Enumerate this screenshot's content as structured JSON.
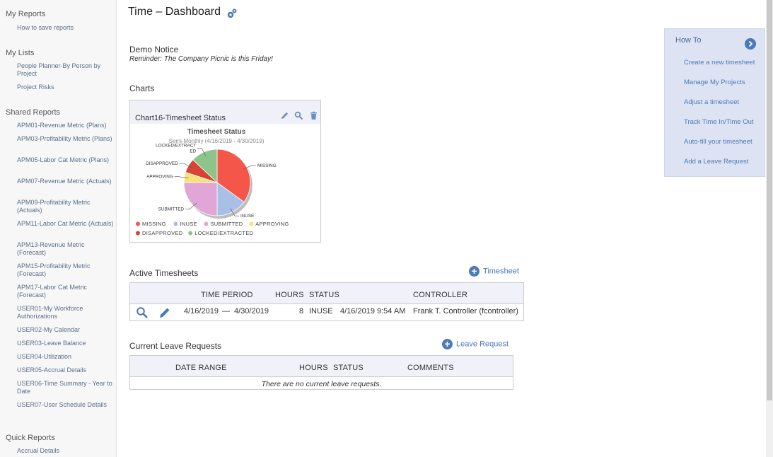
{
  "sidebar": {
    "my_reports": {
      "title": "My Reports",
      "items": [
        "How to save reports"
      ]
    },
    "my_lists": {
      "title": "My Lists",
      "items": [
        "People Planner-By Person by Project",
        "Project Risks"
      ]
    },
    "shared_reports": {
      "title": "Shared Reports",
      "items": [
        "APM01-Revenue Metric (Plans)",
        "APM03-Profitability Metric (Plans)",
        "APM05-Labor Cat Metric (Plans)",
        "APM07-Revenue Metric (Actuals)",
        "APM09-Profitability Metric (Actuals)",
        "APM11-Labor Cat Metric (Actuals)",
        "APM13-Revenue Metric (Forecast)",
        "APM15-Profitability Metric (Forecast)",
        "APM17-Labor Cat Metric (Forecast)",
        "USER01-My Workforce Authorizations",
        "USER02-My Calendar",
        "USER03-Leave Balance",
        "USER04-Utilization",
        "USER05-Accrual Details",
        "USER06-Time Summary - Year to Date",
        "USER07-User Schedule Details"
      ]
    },
    "quick_reports": {
      "title": "Quick Reports",
      "items": [
        "Accrual Details"
      ]
    }
  },
  "page": {
    "title": "Time – Dashboard"
  },
  "notice": {
    "heading": "Demo Notice",
    "text": "Reminder: The Company Picnic is this Friday!"
  },
  "charts": {
    "heading": "Charts",
    "card_title": "Chart16-Timesheet Status",
    "chart_title": "Timesheet Status",
    "chart_subtitle": "Semi-Monthly (4/16/2019 - 4/30/2019)"
  },
  "chart_data": {
    "type": "pie",
    "title": "Timesheet Status",
    "subtitle": "Semi-Monthly (4/16/2019 - 4/30/2019)",
    "legend_position": "bottom",
    "slices": [
      {
        "label": "MISSING",
        "value": 35,
        "color": "#f4574a"
      },
      {
        "label": "INUSE",
        "value": 15,
        "color": "#a8bfe6"
      },
      {
        "label": "SUBMITTED",
        "value": 25,
        "color": "#e2a6d6"
      },
      {
        "label": "APPROVING",
        "value": 5,
        "color": "#f7e27a"
      },
      {
        "label": "DISAPPROVED",
        "value": 7,
        "color": "#d84335"
      },
      {
        "label": "LOCKED/EXTRACTED",
        "value": 13,
        "color": "#8cc48c"
      }
    ],
    "slice_labels": [
      "MISSING",
      "INUSE",
      "SUBMITTED",
      "APPROVING",
      "DISAPPROVED",
      "LOCKED/EXTRACT ED"
    ]
  },
  "active_timesheets": {
    "heading": "Active Timesheets",
    "add_label": "Timesheet",
    "columns": [
      "TIME PERIOD",
      "HOURS",
      "STATUS",
      "CONTROLLER"
    ],
    "rows": [
      {
        "period_start": "4/16/2019",
        "dash": "—",
        "period_end": "4/30/2019",
        "hours": "8",
        "status": "INUSE",
        "status_time": "4/16/2019 9:54 AM",
        "controller": "Frank T. Controller (fcontroller)"
      }
    ]
  },
  "leave_requests": {
    "heading": "Current Leave Requests",
    "add_label": "Leave Request",
    "columns": [
      "DATE RANGE",
      "HOURS",
      "STATUS",
      "COMMENTS"
    ],
    "empty_text": "There are no current leave requests."
  },
  "howto": {
    "title": "How To",
    "items": [
      "Create a new timesheet",
      "Manage My Projects",
      "Adjust a timesheet",
      "Track Time In/Time Out",
      "Auto-fill your timesheet",
      "Add a Leave Request"
    ]
  },
  "colors": {
    "accent": "#4a7ab8",
    "sidebar_link": "#5b6f8c",
    "howto_bg": "#dde3f3"
  }
}
